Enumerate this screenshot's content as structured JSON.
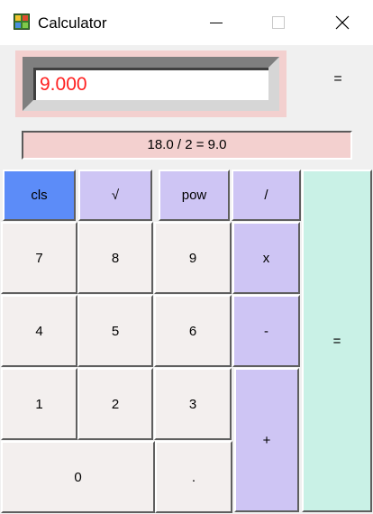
{
  "window": {
    "title": "Calculator",
    "app_icon": "calculator-app-icon",
    "controls": {
      "minimize_icon": "minimize-icon",
      "maximize_icon": "maximize-icon",
      "close_icon": "close-icon"
    }
  },
  "display": {
    "value": "9.000",
    "value_color": "#ff2020",
    "equals_label": "="
  },
  "history": {
    "text": "18.0 / 2 = 9.0"
  },
  "keypad": {
    "cls": "cls",
    "sqrt": "√",
    "pow": "pow",
    "divide": "/",
    "seven": "7",
    "eight": "8",
    "nine": "9",
    "multiply": "x",
    "four": "4",
    "five": "5",
    "six": "6",
    "minus": "-",
    "one": "1",
    "two": "2",
    "three": "3",
    "plus": "+",
    "zero": "0",
    "dot": ".",
    "equals": "="
  },
  "colors": {
    "display_frame_bg": "#f3d0cf",
    "number_key": "#f3efee",
    "operator_key": "#cec5f4",
    "clear_key": "#5c8cf8",
    "equals_key": "#c9f1e6"
  }
}
